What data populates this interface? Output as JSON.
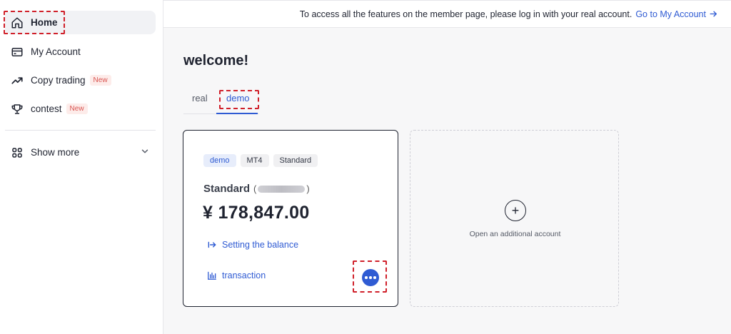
{
  "sidebar": {
    "items": [
      {
        "label": "Home",
        "icon": "home-icon"
      },
      {
        "label": "My Account",
        "icon": "card-icon"
      },
      {
        "label": "Copy trading",
        "icon": "trend-up-icon",
        "badge": "New"
      },
      {
        "label": "contest",
        "icon": "trophy-icon",
        "badge": "New"
      }
    ],
    "show_more": {
      "label": "Show more",
      "icon": "grid-icon"
    }
  },
  "topbar": {
    "notice": "To access all the features on the member page, please log in with your real account.",
    "link": "Go to My Account"
  },
  "main": {
    "welcome": "welcome!",
    "tabs": [
      {
        "label": "real"
      },
      {
        "label": "demo",
        "active": true
      }
    ],
    "account_card": {
      "chips": [
        "demo",
        "MT4",
        "Standard"
      ],
      "name": "Standard",
      "id_open": "(",
      "id_close": ")",
      "balance": "¥ 178,847.00",
      "actions": {
        "setting_balance": "Setting the balance",
        "transaction": "transaction"
      }
    },
    "add_account": {
      "label": "Open an additional account",
      "plus": "+"
    }
  },
  "colors": {
    "accent": "#2f5bd3",
    "highlight": "#d0202a",
    "badge_text": "#d9534f"
  }
}
